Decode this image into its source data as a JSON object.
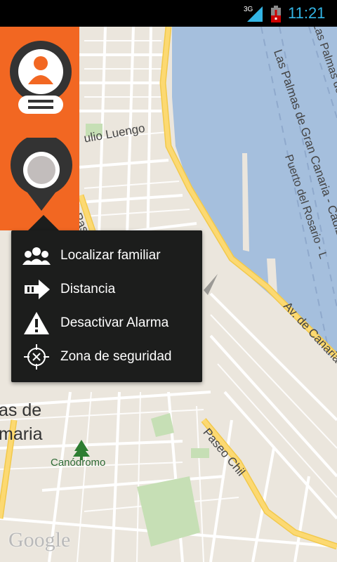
{
  "status_bar": {
    "network": "3G",
    "time": "11:21",
    "time_color": "#33b5e5"
  },
  "map": {
    "labels": {
      "street_luengo": "ulio Luengo",
      "street_paseo_left": "Pase",
      "city_line1": "as de",
      "city_line2": "maria",
      "canodromo": "Canódromo",
      "paseo_chil": "Paseo Chil",
      "av_canarias": "Av. de Canarias",
      "port_1": "Las Palmas de Gran Canaria - Cádiz",
      "port_2": "Puerto del Rosario - L",
      "port_3": "Las Palmas de"
    },
    "attribution": "Google",
    "water_color": "#a5bfdd",
    "land_color": "#ebe6dd",
    "road_color": "#fcd972"
  },
  "side_panel": {
    "accent_color": "#f26722",
    "profile_icon": "user-profile-icon",
    "location_icon": "location-pin-icon"
  },
  "menu": {
    "items": [
      {
        "label": "Localizar familiar",
        "icon": "family-group-icon"
      },
      {
        "label": "Distancia",
        "icon": "arrow-right-icon"
      },
      {
        "label": "Desactivar Alarma",
        "icon": "warning-icon"
      },
      {
        "label": "Zona de seguridad",
        "icon": "crosshair-icon"
      }
    ]
  }
}
